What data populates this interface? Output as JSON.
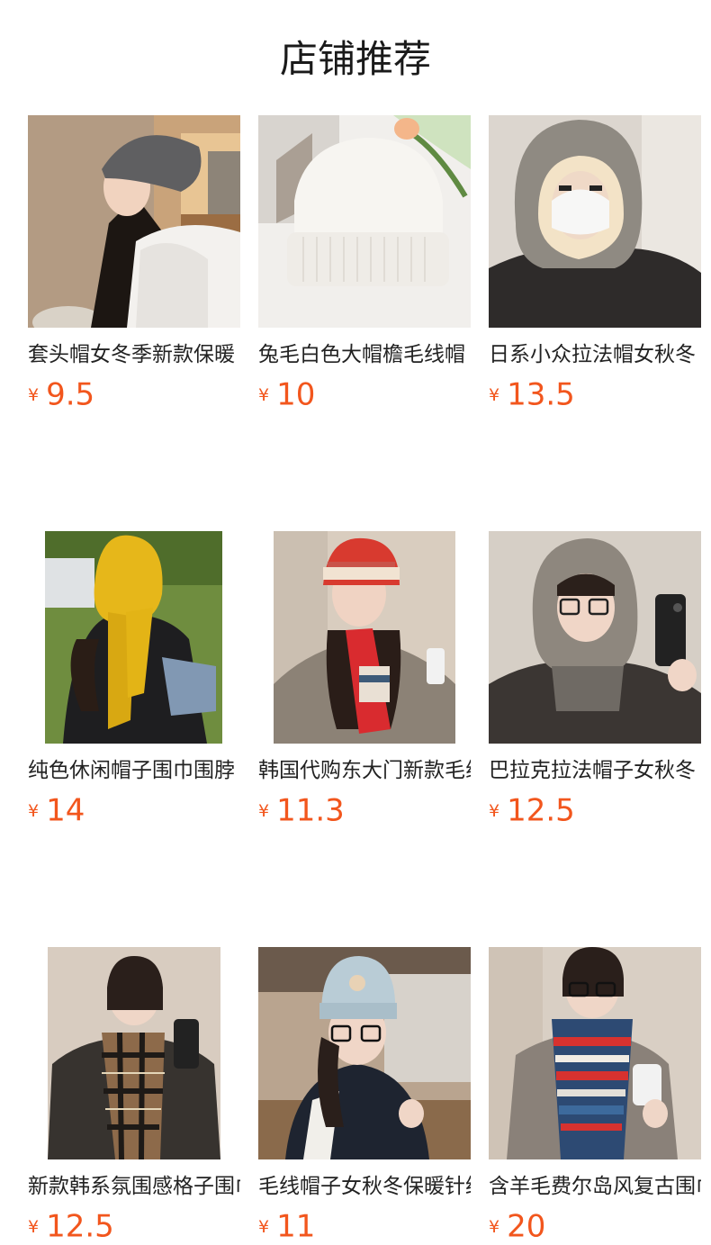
{
  "page": {
    "title": "店铺推荐",
    "currency_symbol": "¥",
    "accent_color": "#f2561d"
  },
  "products": [
    {
      "name": "套头帽女冬季新款保暖",
      "price": "9.5",
      "image": "grey-beanie-girl-photo"
    },
    {
      "name": "兔毛白色大帽檐毛线帽",
      "price": "10",
      "image": "white-knit-hat-photo"
    },
    {
      "name": "日系小众拉法帽女秋冬",
      "price": "13.5",
      "image": "balaclava-hood-photo"
    },
    {
      "name": "纯色休闲帽子围巾围脖",
      "price": "14",
      "image": "yellow-hood-scarf-photo"
    },
    {
      "name": "韩国代购东大门新款毛线",
      "price": "11.3",
      "image": "red-fairisle-hat-scarf-photo"
    },
    {
      "name": "巴拉克拉法帽子女秋冬",
      "price": "12.5",
      "image": "grey-balaclava-mirror-photo"
    },
    {
      "name": "新款韩系氛围感格子围巾",
      "price": "12.5",
      "image": "plaid-scarf-photo"
    },
    {
      "name": "毛线帽子女秋冬保暖针织",
      "price": "11",
      "image": "blue-embroidered-beanie-photo"
    },
    {
      "name": "含羊毛费尔岛风复古围巾",
      "price": "20",
      "image": "fairisle-scarf-photo"
    }
  ]
}
